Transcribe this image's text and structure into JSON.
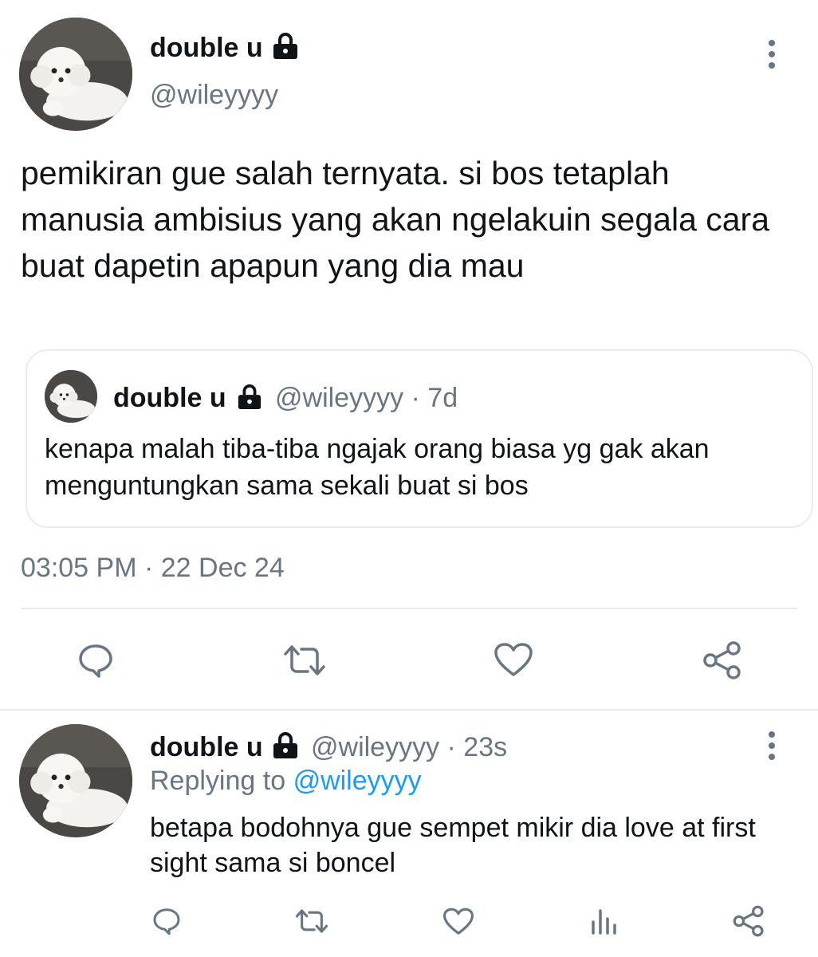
{
  "main_tweet": {
    "display_name": "double u",
    "handle": "@wileyyyy",
    "text": "pemikiran gue salah ternyata. si bos tetaplah manusia ambisius yang akan ngelakuin segala cara buat dapetin apapun yang dia mau",
    "timestamp": "03:05 PM · 22 Dec 24",
    "icons": {
      "lock": "lock-icon",
      "more": "more-vertical-icon",
      "reply": "reply-icon",
      "retweet": "retweet-icon",
      "like": "like-icon",
      "share": "share-icon"
    },
    "quote": {
      "display_name": "double u",
      "handle_time": "@wileyyyy · 7d",
      "text": "kenapa malah tiba-tiba ngajak orang biasa yg gak akan menguntungkan sama sekali buat si bos"
    }
  },
  "reply_tweet": {
    "display_name": "double u",
    "handle_time": "@wileyyyy · 23s",
    "replying_prefix": "Replying to",
    "replying_handle": "@wileyyyy",
    "text": "betapa bodohnya gue sempet mikir dia love at first sight sama si boncel",
    "icons": {
      "reply": "reply-icon",
      "retweet": "retweet-icon",
      "like": "like-icon",
      "analytics": "analytics-icon",
      "share": "share-icon"
    }
  },
  "colors": {
    "text": "#0f1419",
    "muted": "#687684",
    "link": "#1d9bf0",
    "border": "#e6ecf0"
  }
}
